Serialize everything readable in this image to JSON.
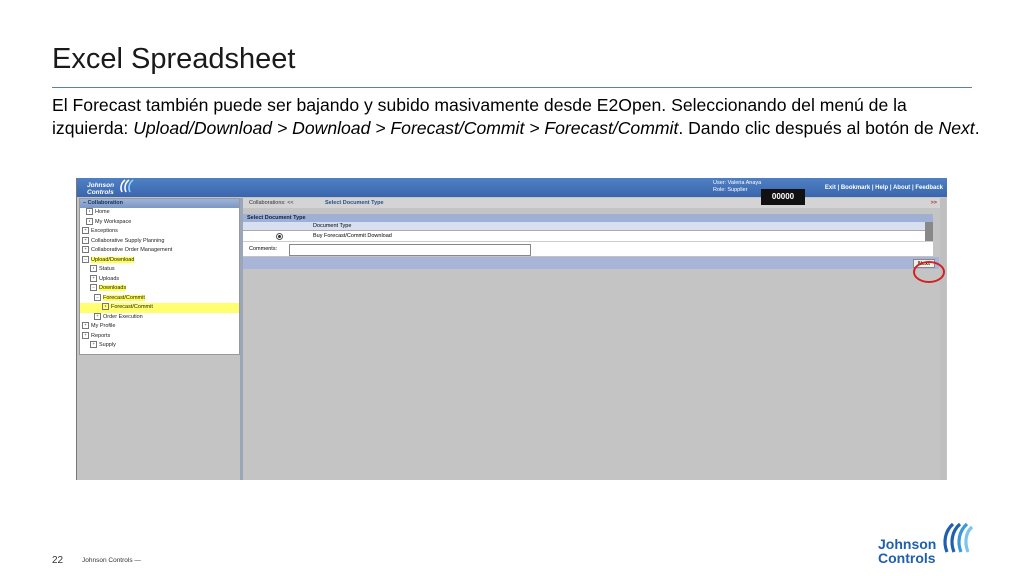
{
  "slide": {
    "title": "Excel Spreadsheet",
    "body_intro": "El Forecast también puede ser bajando y subido masivamente desde E2Open. Seleccionando del menú de la izquierda: ",
    "body_path": "Upload/Download > Download > Forecast/Commit > Forecast/Commit",
    "body_mid": ". Dando clic después al botón de ",
    "body_next": "Next",
    "body_end": ".",
    "page_number": "22",
    "footer_company": "Johnson Controls —",
    "logo_line1": "Johnson",
    "logo_line2": "Controls"
  },
  "app": {
    "logo_line1": "Johnson",
    "logo_line2": "Controls",
    "user_name": "User: Valeria  Anaya",
    "user_role": "Role: Supplier",
    "badge": "00000",
    "topnav": "Exit | Bookmark | Help | About | Feedback",
    "left_header": "– Collaboration",
    "menu": [
      {
        "label": "Home",
        "icon": "•",
        "indent": 6,
        "hl": ""
      },
      {
        "label": "My Workspace",
        "icon": "•",
        "indent": 6,
        "hl": ""
      },
      {
        "label": "Exceptions",
        "icon": "+",
        "indent": 2,
        "hl": ""
      },
      {
        "label": "Collaborative Supply Planning",
        "icon": "+",
        "indent": 2,
        "hl": ""
      },
      {
        "label": "Collaborative Order Management",
        "icon": "+",
        "indent": 2,
        "hl": ""
      },
      {
        "label": "Upload/Download",
        "icon": "–",
        "indent": 2,
        "hl": "hl"
      },
      {
        "label": "Status",
        "icon": "•",
        "indent": 10,
        "hl": ""
      },
      {
        "label": "Uploads",
        "icon": "+",
        "indent": 10,
        "hl": ""
      },
      {
        "label": "Downloads",
        "icon": "–",
        "indent": 10,
        "hl": "hl"
      },
      {
        "label": "Forecast/Commit",
        "icon": "–",
        "indent": 14,
        "hl": "hl"
      },
      {
        "label": "Forecast/Commit",
        "icon": "•",
        "indent": 22,
        "hl": "hl-row"
      },
      {
        "label": "Order Execution",
        "icon": "+",
        "indent": 14,
        "hl": ""
      },
      {
        "label": "My Profile",
        "icon": "+",
        "indent": 2,
        "hl": ""
      },
      {
        "label": "Reports",
        "icon": "+",
        "indent": 2,
        "hl": ""
      },
      {
        "label": "Supply",
        "icon": "+",
        "indent": 10,
        "hl": ""
      }
    ],
    "crumb_left": "Collaborations: <<",
    "crumb_selected": "Select Document Type",
    "crumb_right": ">>",
    "section_header": "Select Document Type",
    "table_header": "Document Type",
    "row_label": "Buy Forecast/Commit Download",
    "comments_label": "Comments:",
    "next_label": "Next"
  }
}
